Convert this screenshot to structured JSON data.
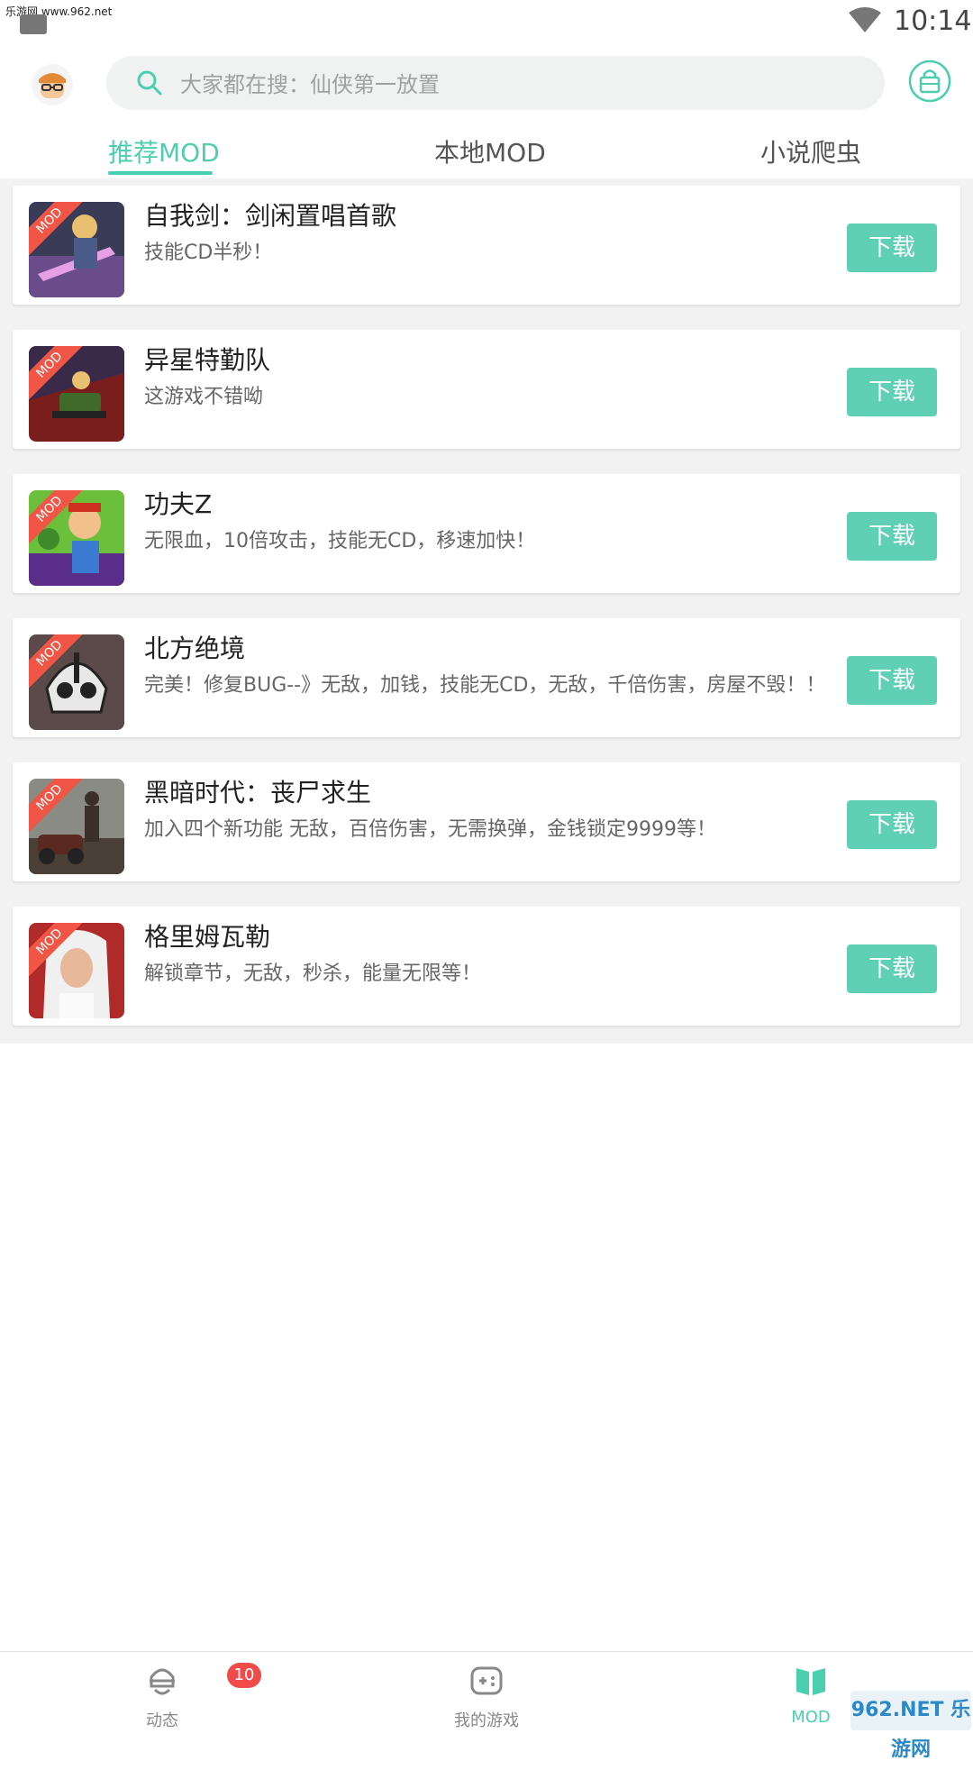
{
  "watermark_top": "乐游网 www.962.net",
  "status_bar": {
    "time": "10:14"
  },
  "search": {
    "placeholder": "大家都在搜：仙侠第一放置"
  },
  "tabs": [
    {
      "label": "推荐MOD",
      "active": true
    },
    {
      "label": "本地MOD",
      "active": false
    },
    {
      "label": "小说爬虫",
      "active": false
    }
  ],
  "mod_badge": "MOD",
  "mods": [
    {
      "title": "自我剑：剑闲置唱首歌",
      "desc": "技能CD半秒！",
      "button": "下载"
    },
    {
      "title": "异星特勤队",
      "desc": "这游戏不错呦",
      "button": "下载"
    },
    {
      "title": "功夫Z",
      "desc": "无限血，10倍攻击，技能无CD，移速加快！",
      "button": "下载"
    },
    {
      "title": "北方绝境",
      "desc": "完美！修复BUG--》无敌，加钱，技能无CD，无敌，千倍伤害，房屋不毁！！",
      "button": "下载"
    },
    {
      "title": "黑暗时代：丧尸求生",
      "desc": "加入四个新功能 无敌，百倍伤害，无需换弹，金钱锁定9999等！",
      "button": "下载"
    },
    {
      "title": "格里姆瓦勒",
      "desc": "解锁章节，无敌，秒杀，能量无限等！",
      "button": "下载"
    }
  ],
  "bottom_nav": [
    {
      "label": "动态",
      "badge": "10"
    },
    {
      "label": "我的游戏"
    },
    {
      "label": "MOD",
      "active": true
    }
  ],
  "watermark_br": "962.NET 乐游网",
  "colors": {
    "accent": "#4ccfb0",
    "download": "#5fd0b6",
    "badge": "#f04a4a",
    "mod_ribbon": "#f05545"
  }
}
